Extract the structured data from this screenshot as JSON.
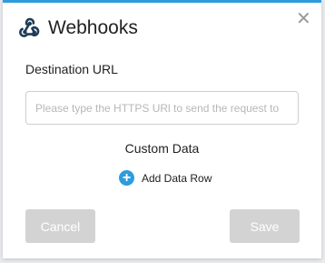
{
  "dialog": {
    "title": "Webhooks",
    "close_icon": "close-icon",
    "logo_icon": "webhooks-logo-icon",
    "accent_color": "#2d9cdb"
  },
  "destination": {
    "label": "Destination URL",
    "value": "",
    "placeholder": "Please type the HTTPS URl to send the request to"
  },
  "custom_data": {
    "title": "Custom Data",
    "add_row_label": "Add Data Row",
    "add_icon": "plus-circle-icon"
  },
  "actions": {
    "cancel_label": "Cancel",
    "save_label": "Save"
  }
}
